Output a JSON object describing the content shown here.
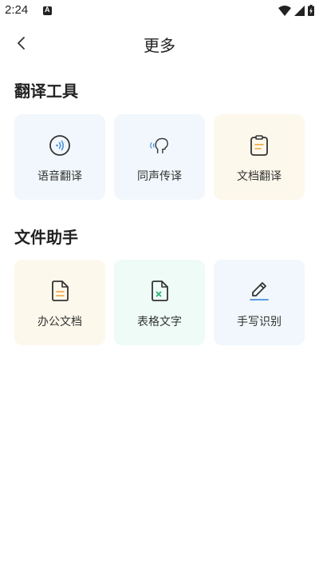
{
  "status_bar": {
    "time": "2:24"
  },
  "nav": {
    "title": "更多"
  },
  "sections": [
    {
      "title": "翻译工具",
      "items": [
        {
          "label": "语音翻译",
          "icon": "voice-translate-icon"
        },
        {
          "label": "同声传译",
          "icon": "simultaneous-interpret-icon"
        },
        {
          "label": "文档翻译",
          "icon": "document-translate-icon"
        }
      ]
    },
    {
      "title": "文件助手",
      "items": [
        {
          "label": "办公文档",
          "icon": "office-document-icon"
        },
        {
          "label": "表格文字",
          "icon": "spreadsheet-text-icon"
        },
        {
          "label": "手写识别",
          "icon": "handwriting-recognition-icon"
        }
      ]
    }
  ],
  "colors": {
    "blue_card": "#f1f7fc",
    "cream_card": "#fdf8ec",
    "mint_card": "#eefbf6",
    "accent_blue": "#4a90d9",
    "accent_orange": "#f0a030",
    "accent_green": "#2fb37a"
  }
}
